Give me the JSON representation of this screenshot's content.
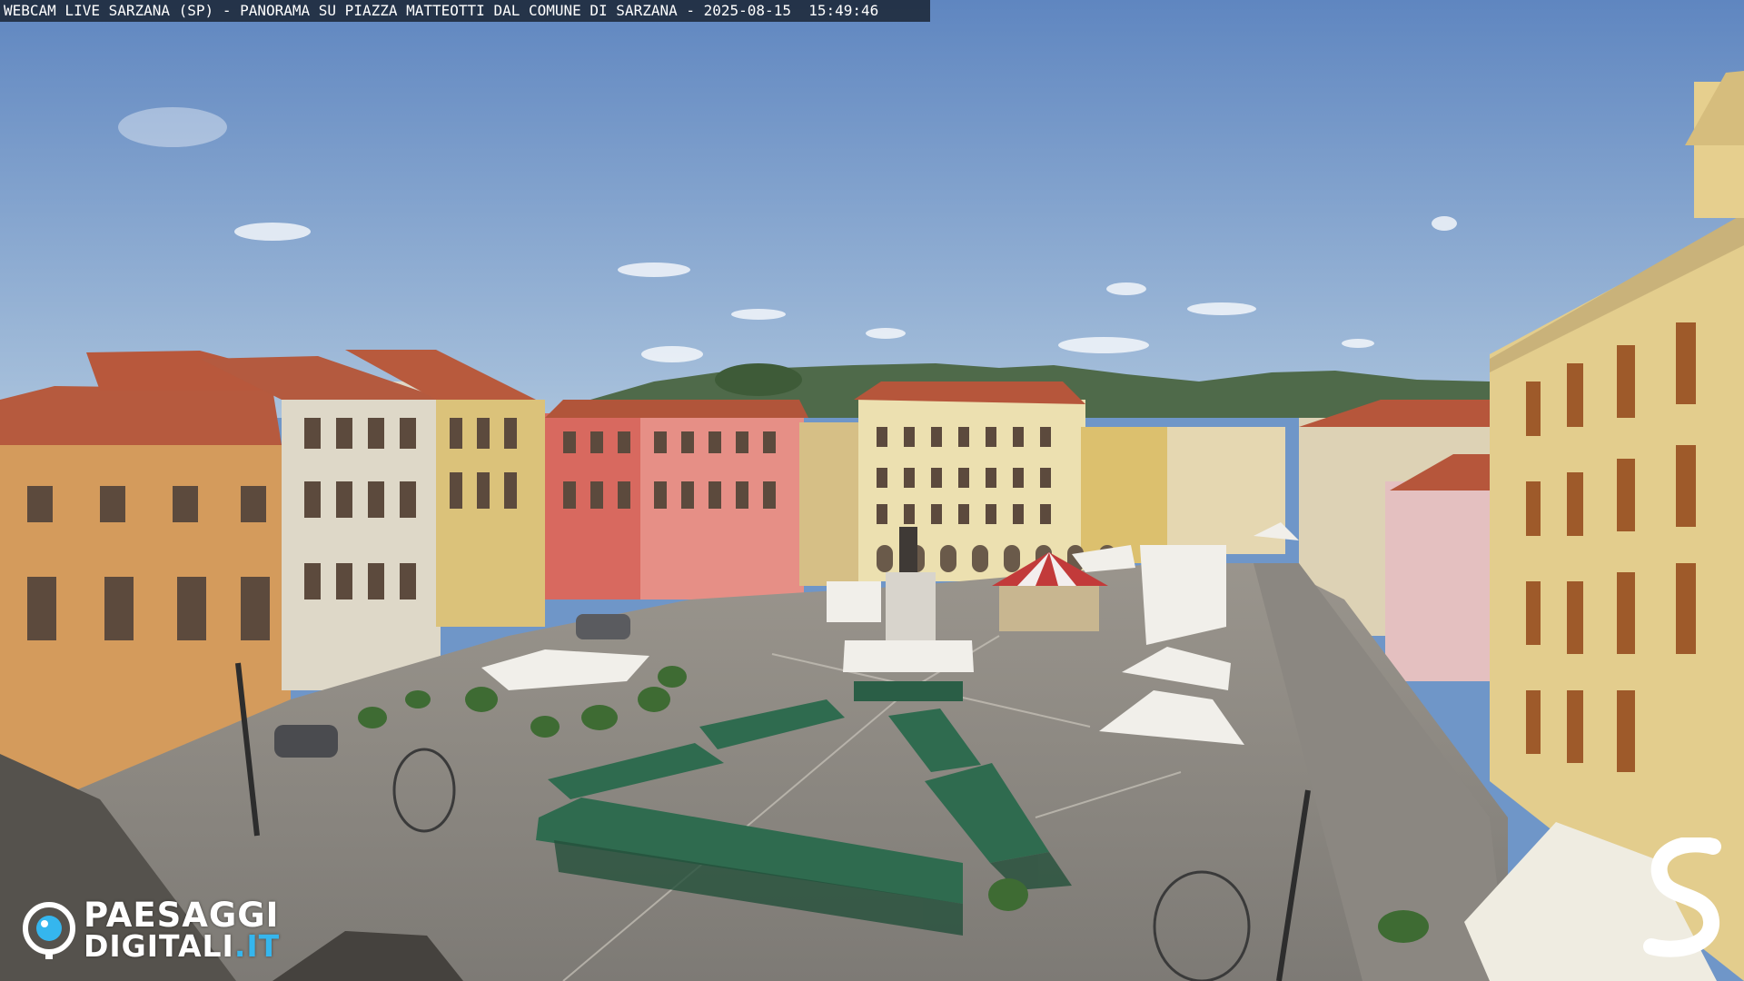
{
  "overlay": {
    "caption": "WEBCAM LIVE SARZANA (SP) - PANORAMA SU PIAZZA MATTEOTTI DAL COMUNE DI SARZANA - 2025-08-15  15:49:46"
  },
  "logo": {
    "line1": "PAESAGGI",
    "line2_main": "DIGITALI",
    "line2_suffix": ".IT",
    "icon": "eye-camera-icon",
    "accent_color": "#35b6ee"
  },
  "corner_mark": {
    "icon": "stylized-s-logo"
  },
  "scene": {
    "sky_color": "#6f96c8",
    "pavement_color": "#8d8a85",
    "awning_color": "#2f6b4f"
  }
}
